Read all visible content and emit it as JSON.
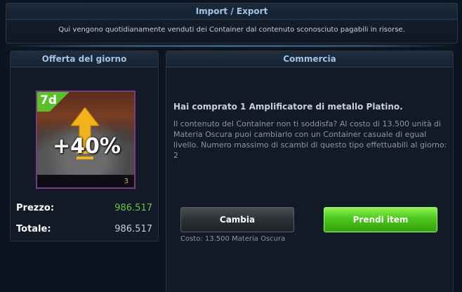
{
  "header": {
    "title": "Import / Export",
    "description": "Qui vengono quotidianamente venduti dei Container dal contenuto sconosciuto pagabili in risorse."
  },
  "offer": {
    "title": "Offerta del giorno",
    "item": {
      "days": "7d",
      "bonus": "+40%",
      "count": "3",
      "rarity_color": "#7a3a86"
    },
    "price_label": "Prezzo:",
    "price_value": "986.517",
    "total_label": "Totale:",
    "total_value": "986.517"
  },
  "trade": {
    "title": "Commercia",
    "purchase_title": "Hai comprato 1 Amplificatore di metallo Platino.",
    "purchase_desc": "Il contenuto del Container non ti soddisfa? Al costo di 13.500 unità di Materia Oscura puoi cambiarlo con un Container casuale di egual livello. Numero massimo di scambi di questo tipo effettuabili al giorno: 2",
    "change_button": "Cambia",
    "change_cost": "Costo: 13.500 Materia Oscura",
    "take_button": "Prendi item"
  },
  "colors": {
    "accent": "#9fc4e8",
    "price_green": "#5fc84a",
    "button_green": "#4bc81c"
  }
}
